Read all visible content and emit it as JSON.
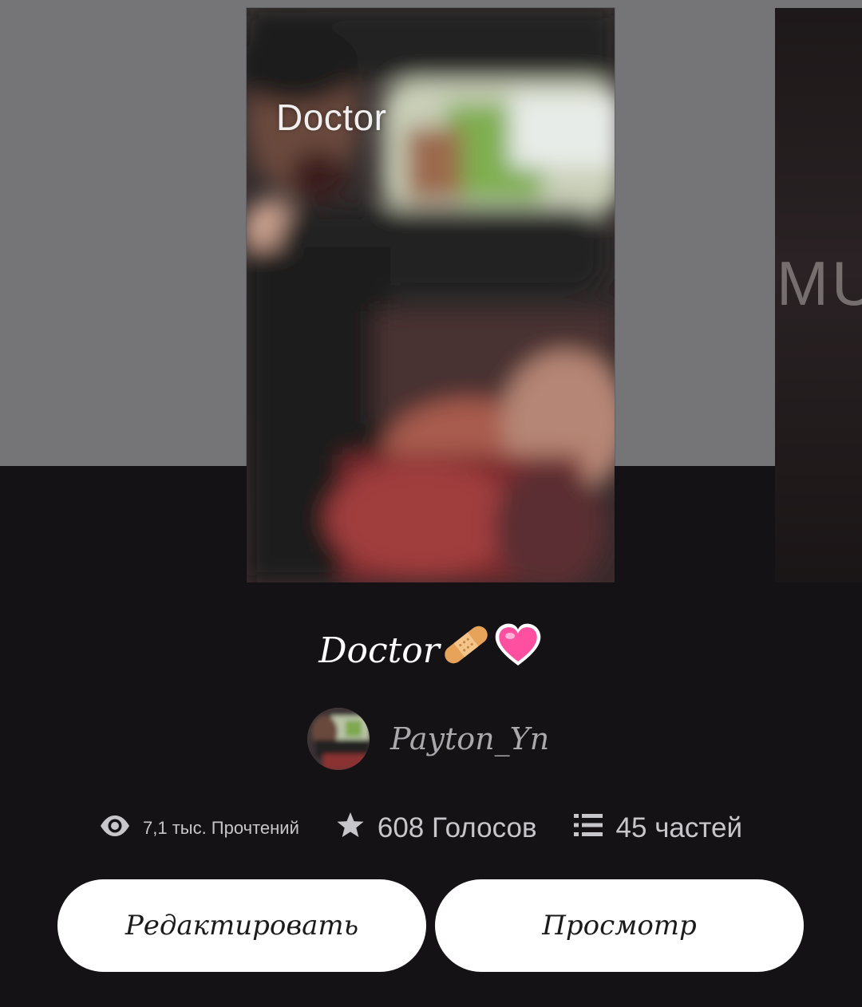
{
  "cover": {
    "title": "Doctor",
    "next_cover_text": "MU"
  },
  "story": {
    "title": "Doctor",
    "title_emojis": [
      "bandage-emoji",
      "heart-emoji"
    ]
  },
  "author": {
    "name": "Payton_Yn"
  },
  "stats": {
    "reads": "7,1 тыс. Прочтений",
    "votes": "608 Голосов",
    "parts": "45 частей"
  },
  "actions": {
    "edit_label": "Редактировать",
    "view_label": "Просмотр"
  },
  "colors": {
    "background": "#141215",
    "top_band": "#757477",
    "button": "#ffffff",
    "stat_text": "#c6c6cb",
    "author_text": "#a9a8ad",
    "heart": "#ff4fa0",
    "bandage": "#e8a35a"
  }
}
